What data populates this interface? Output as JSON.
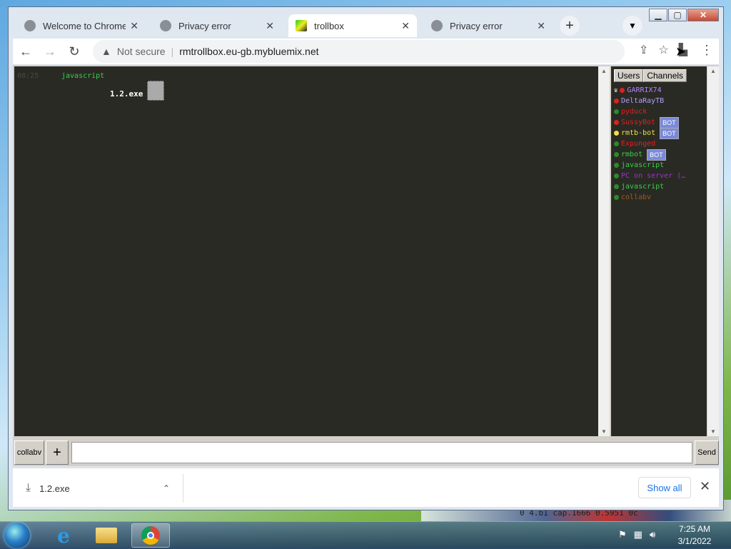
{
  "window": {
    "minimize_icon": "minimize-icon",
    "maximize_icon": "maximize-icon",
    "close_icon": "close-icon"
  },
  "tabs": [
    {
      "title": "Welcome to Chrome",
      "icon": "globe-icon",
      "active": false
    },
    {
      "title": "Privacy error",
      "icon": "globe-icon",
      "active": false
    },
    {
      "title": "trollbox",
      "icon": "trollbox-favicon",
      "active": true
    },
    {
      "title": "Privacy error",
      "icon": "globe-icon",
      "active": false
    }
  ],
  "toolbar": {
    "not_secure": "Not secure",
    "url": "rmtrollbox.eu-gb.mybluemix.net"
  },
  "chat": {
    "messages": [
      {
        "time": "08:25",
        "nick": "javascript",
        "nick_color": "#35d04a",
        "text": "1.2.exe"
      }
    ]
  },
  "sidebar": {
    "tab_users": "Users",
    "tab_channels": "Channels",
    "users": [
      {
        "name": "GARRIX74",
        "color": "#b080ff",
        "dot": "#e02020",
        "crown": true,
        "bot": false
      },
      {
        "name": "DeltaRayTB",
        "color": "#b0a0ff",
        "dot": "#e02020",
        "crown": false,
        "bot": false
      },
      {
        "name": "pyduck",
        "color": "#e02020",
        "dot": "#2a8a2a",
        "crown": false,
        "bot": false
      },
      {
        "name": "SussyBot",
        "color": "#e02020",
        "dot": "#e02020",
        "crown": false,
        "bot": true
      },
      {
        "name": "rmtb-bot",
        "color": "#f0e040",
        "dot": "#f0e040",
        "crown": false,
        "bot": true
      },
      {
        "name": "Expunged",
        "color": "#e02020",
        "dot": "#2a8a2a",
        "crown": false,
        "bot": false
      },
      {
        "name": "rmbot",
        "color": "#35d04a",
        "dot": "#2a8a2a",
        "crown": false,
        "bot": true
      },
      {
        "name": "javascript",
        "color": "#35d04a",
        "dot": "#2a8a2a",
        "crown": false,
        "bot": false
      },
      {
        "name": "PC on server (…",
        "color": "#9a30d0",
        "dot": "#2a8a2a",
        "crown": false,
        "bot": false
      },
      {
        "name": "javascript",
        "color": "#35d04a",
        "dot": "#2a8a2a",
        "crown": false,
        "bot": false
      },
      {
        "name": "collabv",
        "color": "#a05a20",
        "dot": "#2a8a2a",
        "crown": false,
        "bot": false
      }
    ],
    "bot_label": "BOT"
  },
  "inputrow": {
    "channel": "collabv",
    "add": "+",
    "send": "Send",
    "message_value": ""
  },
  "downloads": {
    "file": "1.2.exe",
    "show_all": "Show all"
  },
  "taskbar": {
    "time": "7:25 AM",
    "date": "3/1/2022"
  },
  "desktop": {
    "partial_text": "0 4.b1 cap.1666 0.5951 0c"
  }
}
